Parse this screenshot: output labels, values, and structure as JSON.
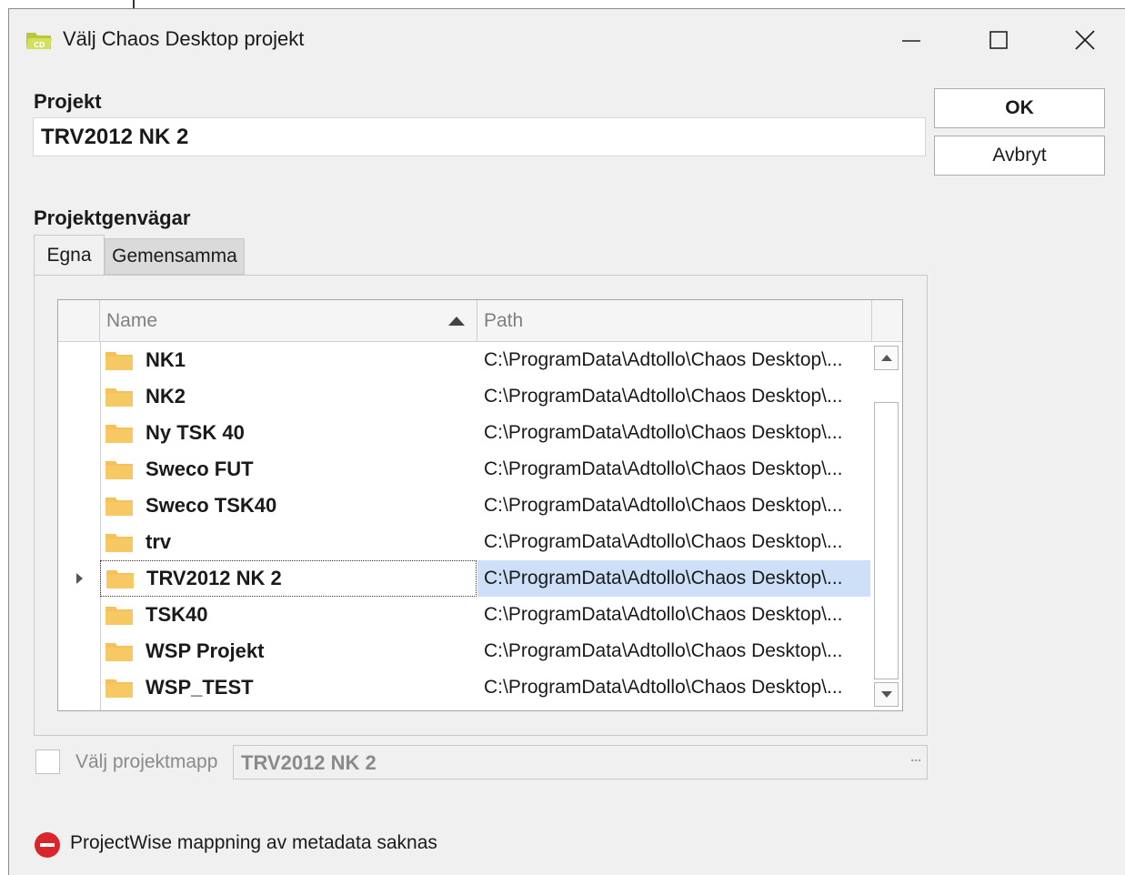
{
  "window": {
    "title": "Välj Chaos Desktop projekt",
    "minimize_icon": "minimize-icon",
    "maximize_icon": "maximize-icon",
    "close_icon": "close-icon"
  },
  "projekt": {
    "label": "Projekt",
    "value": "TRV2012 NK 2"
  },
  "buttons": {
    "ok": "OK",
    "cancel": "Avbryt"
  },
  "shortcuts": {
    "label": "Projektgenvägar",
    "tabs": [
      {
        "label": "Egna",
        "active": true
      },
      {
        "label": "Gemensamma",
        "active": false
      }
    ],
    "columns": {
      "name": "Name",
      "path": "Path",
      "sort_icon": "sort-ascending-icon"
    },
    "rows": [
      {
        "name": "NK1",
        "path": "C:\\ProgramData\\Adtollo\\Chaos Desktop\\..."
      },
      {
        "name": "NK2",
        "path": "C:\\ProgramData\\Adtollo\\Chaos Desktop\\..."
      },
      {
        "name": "Ny TSK 40",
        "path": "C:\\ProgramData\\Adtollo\\Chaos Desktop\\..."
      },
      {
        "name": "Sweco FUT",
        "path": "C:\\ProgramData\\Adtollo\\Chaos Desktop\\..."
      },
      {
        "name": "Sweco TSK40",
        "path": "C:\\ProgramData\\Adtollo\\Chaos Desktop\\..."
      },
      {
        "name": "trv",
        "path": "C:\\ProgramData\\Adtollo\\Chaos Desktop\\..."
      },
      {
        "name": "TRV2012 NK 2",
        "path": "C:\\ProgramData\\Adtollo\\Chaos Desktop\\...",
        "selected": true
      },
      {
        "name": "TSK40",
        "path": "C:\\ProgramData\\Adtollo\\Chaos Desktop\\..."
      },
      {
        "name": "WSP Projekt",
        "path": "C:\\ProgramData\\Adtollo\\Chaos Desktop\\..."
      },
      {
        "name": "WSP_TEST",
        "path": "C:\\ProgramData\\Adtollo\\Chaos Desktop\\..."
      }
    ]
  },
  "project_folder": {
    "checkbox_label": "Välj projektmapp",
    "checked": false,
    "value": "TRV2012 NK 2",
    "browse": "..."
  },
  "status": {
    "icon": "error-icon",
    "text": "ProjectWise mappning av metadata saknas"
  },
  "colors": {
    "selection": "#cde0f7",
    "folder": "#f5c15c",
    "error": "#d9262c",
    "app_icon": "#c8d84a"
  }
}
